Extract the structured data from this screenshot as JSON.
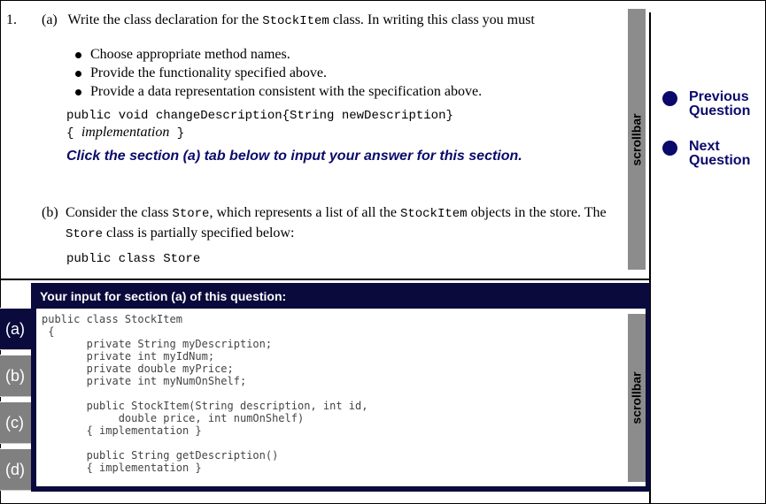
{
  "question": {
    "number": "1.",
    "part_a": {
      "label": "(a)",
      "intro_pre": "Write the class declaration for the ",
      "intro_code": "StockItem",
      "intro_post": " class. In writing this class you must",
      "bullets": [
        "Choose appropriate method names.",
        "Provide the functionality specified above.",
        "Provide a data representation consistent with the specification above."
      ],
      "code_line1": "public void changeDescription{String newDescription}",
      "code_line2_brace_open": "{ ",
      "code_line2_italic": "implementation",
      "code_line2_brace_close": " }",
      "instruction": "Click the section (a) tab below to input your answer for this section."
    },
    "part_b": {
      "label": "(b)",
      "t1": "Consider the class ",
      "c1": "Store",
      "t2": ", which represents a list of all the ",
      "c2": "StockItem",
      "t3": " objects in the store. The ",
      "c3": "Store",
      "t4": " class is partially specified below:",
      "code_line1": "public class Store"
    },
    "scrollbar_label": "scrollbar"
  },
  "navigation": {
    "previous_label": "Previous\nQuestion",
    "next_label": "Next\nQuestion"
  },
  "answer": {
    "header": "Your input for section (a) of this question:",
    "text": "public class StockItem\n {\n       private String myDescription;\n       private int myIdNum;\n       private double myPrice;\n       private int myNumOnShelf;\n\n       public StockItem(String description, int id,\n            double price, int numOnShelf)\n       { implementation }\n\n       public String getDescription()\n       { implementation }",
    "scrollbar_label": "scrollbar",
    "tabs": [
      {
        "label": "(a)",
        "active": true
      },
      {
        "label": "(b)",
        "active": false
      },
      {
        "label": "(c)",
        "active": false
      },
      {
        "label": "(d)",
        "active": false
      }
    ]
  },
  "colors": {
    "accent_navy": "#0a0a6b",
    "answer_panel": "#0a0a3c",
    "scrollbar_gray": "#8c8c8c",
    "tab_gray": "#808080"
  }
}
